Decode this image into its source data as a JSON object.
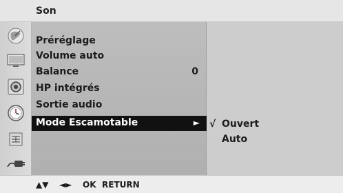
{
  "menu": {
    "title": "Son",
    "items": [
      {
        "label": "Préréglage",
        "value": ""
      },
      {
        "label": "Volume auto",
        "value": ""
      },
      {
        "label": "Balance",
        "value": "0"
      },
      {
        "label": "HP intégrés",
        "value": ""
      },
      {
        "label": "Sortie audio",
        "value": ""
      },
      {
        "label": "Mode Escamotable",
        "value": "",
        "selected": true,
        "arrow": "►"
      }
    ]
  },
  "submenu": {
    "options": [
      {
        "check": "√",
        "label": "Ouvert",
        "checked": true
      },
      {
        "check": "",
        "label": "Auto",
        "checked": false
      }
    ]
  },
  "side_icons": [
    "satellite-dish-icon",
    "monitor-icon",
    "speaker-icon",
    "clock-icon",
    "lock-icon",
    "input-plug-icon"
  ],
  "nav": {
    "updown": "▲▼",
    "leftright": "◄►",
    "ok": "OK",
    "return": "RETURN"
  },
  "colors": {
    "selected_bg": "#111111",
    "panel_bg": "#b6b6b6",
    "sub_panel_bg": "#cdcdcd"
  }
}
